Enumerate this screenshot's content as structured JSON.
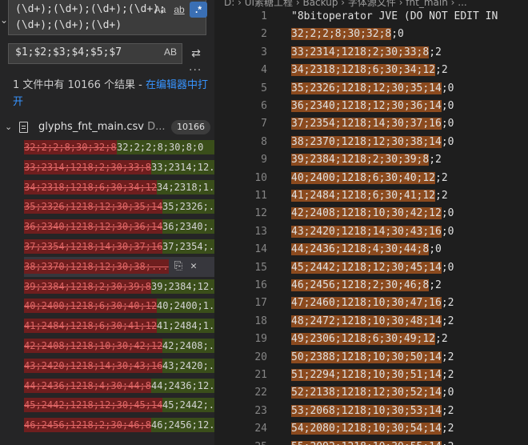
{
  "search": {
    "query": "(\\d+);(\\d+);(\\d+);(\\d+);\n(\\d+);(\\d+);(\\d+)",
    "options": {
      "match_case": "Aa",
      "whole_word": "ab",
      "regex": ".*"
    },
    "replace_value": "$1;$2;$3;$4;$5;$7",
    "preserve_case": "AB"
  },
  "results": {
    "message": "1 文件中有 10166 个结果 - ",
    "open_in_editor": "在编辑器中打开"
  },
  "file": {
    "name": "glyphs_fnt_main.csv",
    "dir": "D...",
    "count": "10166"
  },
  "matches": [
    {
      "old": "32;2;2;8;30;32;8",
      "new": "32;2;2;8;30;8;0"
    },
    {
      "old": "33;2314;1218;2;30;33;8",
      "new": "33;2314;12..."
    },
    {
      "old": "34;2318;1218;6;30;34;12",
      "new": "34;2318;1..."
    },
    {
      "old": "35;2326;1218;12;30;35;14",
      "new": "35;2326;..."
    },
    {
      "old": "36;2340;1218;12;30;36;14",
      "new": "36;2340;..."
    },
    {
      "old": "37;2354;1218;14;30;37;16",
      "new": "37;2354;..."
    },
    {
      "old": "38;2370;1218;12;30;38;...",
      "new": "",
      "selected": true
    },
    {
      "old": "39;2384;1218;2;30;39;8",
      "new": "39;2384;12..."
    },
    {
      "old": "40;2400;1218;6;30;40;12",
      "new": "40;2400;1..."
    },
    {
      "old": "41;2484;1218;6;30;41;12",
      "new": "41;2484;1..."
    },
    {
      "old": "42;2408;1218;10;30;42;12",
      "new": "42;2408;..."
    },
    {
      "old": "43;2420;1218;14;30;43;16",
      "new": "43;2420;..."
    },
    {
      "old": "44;2436;1218;4;30;44;8",
      "new": "44;2436;12..."
    },
    {
      "old": "45;2442;1218;12;30;45;14",
      "new": "45;2442;..."
    },
    {
      "old": "46;2456;1218;2;30;46;8",
      "new": "46;2456;12..."
    }
  ],
  "editor": {
    "breadcrumb": "D: › UI素糖工程 › Backup › 字体源文件 › fnt_main › ...",
    "lines": [
      {
        "n": "1",
        "hl": "",
        "rest": "\"8bitoperator JVE (DO NOT EDIT IN"
      },
      {
        "n": "2",
        "hl": "32;2;2;8;30;32;8",
        "rest": ";0"
      },
      {
        "n": "3",
        "hl": "33;2314;1218;2;30;33;8",
        "rest": ";2"
      },
      {
        "n": "4",
        "hl": "34;2318;1218;6;30;34;12",
        "rest": ";2"
      },
      {
        "n": "5",
        "hl": "35;2326;1218;12;30;35;14",
        "rest": ";0"
      },
      {
        "n": "6",
        "hl": "36;2340;1218;12;30;36;14",
        "rest": ";0"
      },
      {
        "n": "7",
        "hl": "37;2354;1218;14;30;37;16",
        "rest": ";0"
      },
      {
        "n": "8",
        "hl": "38;2370;1218;12;30;38;14",
        "rest": ";0"
      },
      {
        "n": "9",
        "hl": "39;2384;1218;2;30;39;8",
        "rest": ";2"
      },
      {
        "n": "10",
        "hl": "40;2400;1218;6;30;40;12",
        "rest": ";2"
      },
      {
        "n": "11",
        "hl": "41;2484;1218;6;30;41;12",
        "rest": ";2"
      },
      {
        "n": "12",
        "hl": "42;2408;1218;10;30;42;12",
        "rest": ";0"
      },
      {
        "n": "13",
        "hl": "43;2420;1218;14;30;43;16",
        "rest": ";0"
      },
      {
        "n": "14",
        "hl": "44;2436;1218;4;30;44;8",
        "rest": ";0"
      },
      {
        "n": "15",
        "hl": "45;2442;1218;12;30;45;14",
        "rest": ";0"
      },
      {
        "n": "16",
        "hl": "46;2456;1218;2;30;46;8",
        "rest": ";2"
      },
      {
        "n": "17",
        "hl": "47;2460;1218;10;30;47;16",
        "rest": ";2"
      },
      {
        "n": "18",
        "hl": "48;2472;1218;10;30;48;14",
        "rest": ";2"
      },
      {
        "n": "19",
        "hl": "49;2306;1218;6;30;49;12",
        "rest": ";2"
      },
      {
        "n": "20",
        "hl": "50;2388;1218;10;30;50;14",
        "rest": ";2"
      },
      {
        "n": "21",
        "hl": "51;2294;1218;10;30;51;14",
        "rest": ";2"
      },
      {
        "n": "22",
        "hl": "52;2138;1218;12;30;52;14",
        "rest": ";0"
      },
      {
        "n": "23",
        "hl": "53;2068;1218;10;30;53;14",
        "rest": ";2"
      },
      {
        "n": "24",
        "hl": "54;2080;1218;10;30;54;14",
        "rest": ";2"
      },
      {
        "n": "25",
        "hl": "55;2092;1218;10;30;55;14",
        "rest": ";2"
      }
    ]
  },
  "colors": {
    "match_highlight": "#8b4a1e",
    "deleted_bg": "#6e1e1e",
    "inserted_bg": "#3a4e1a",
    "regex_active": "#3a6fb4",
    "link": "#3794ff"
  }
}
